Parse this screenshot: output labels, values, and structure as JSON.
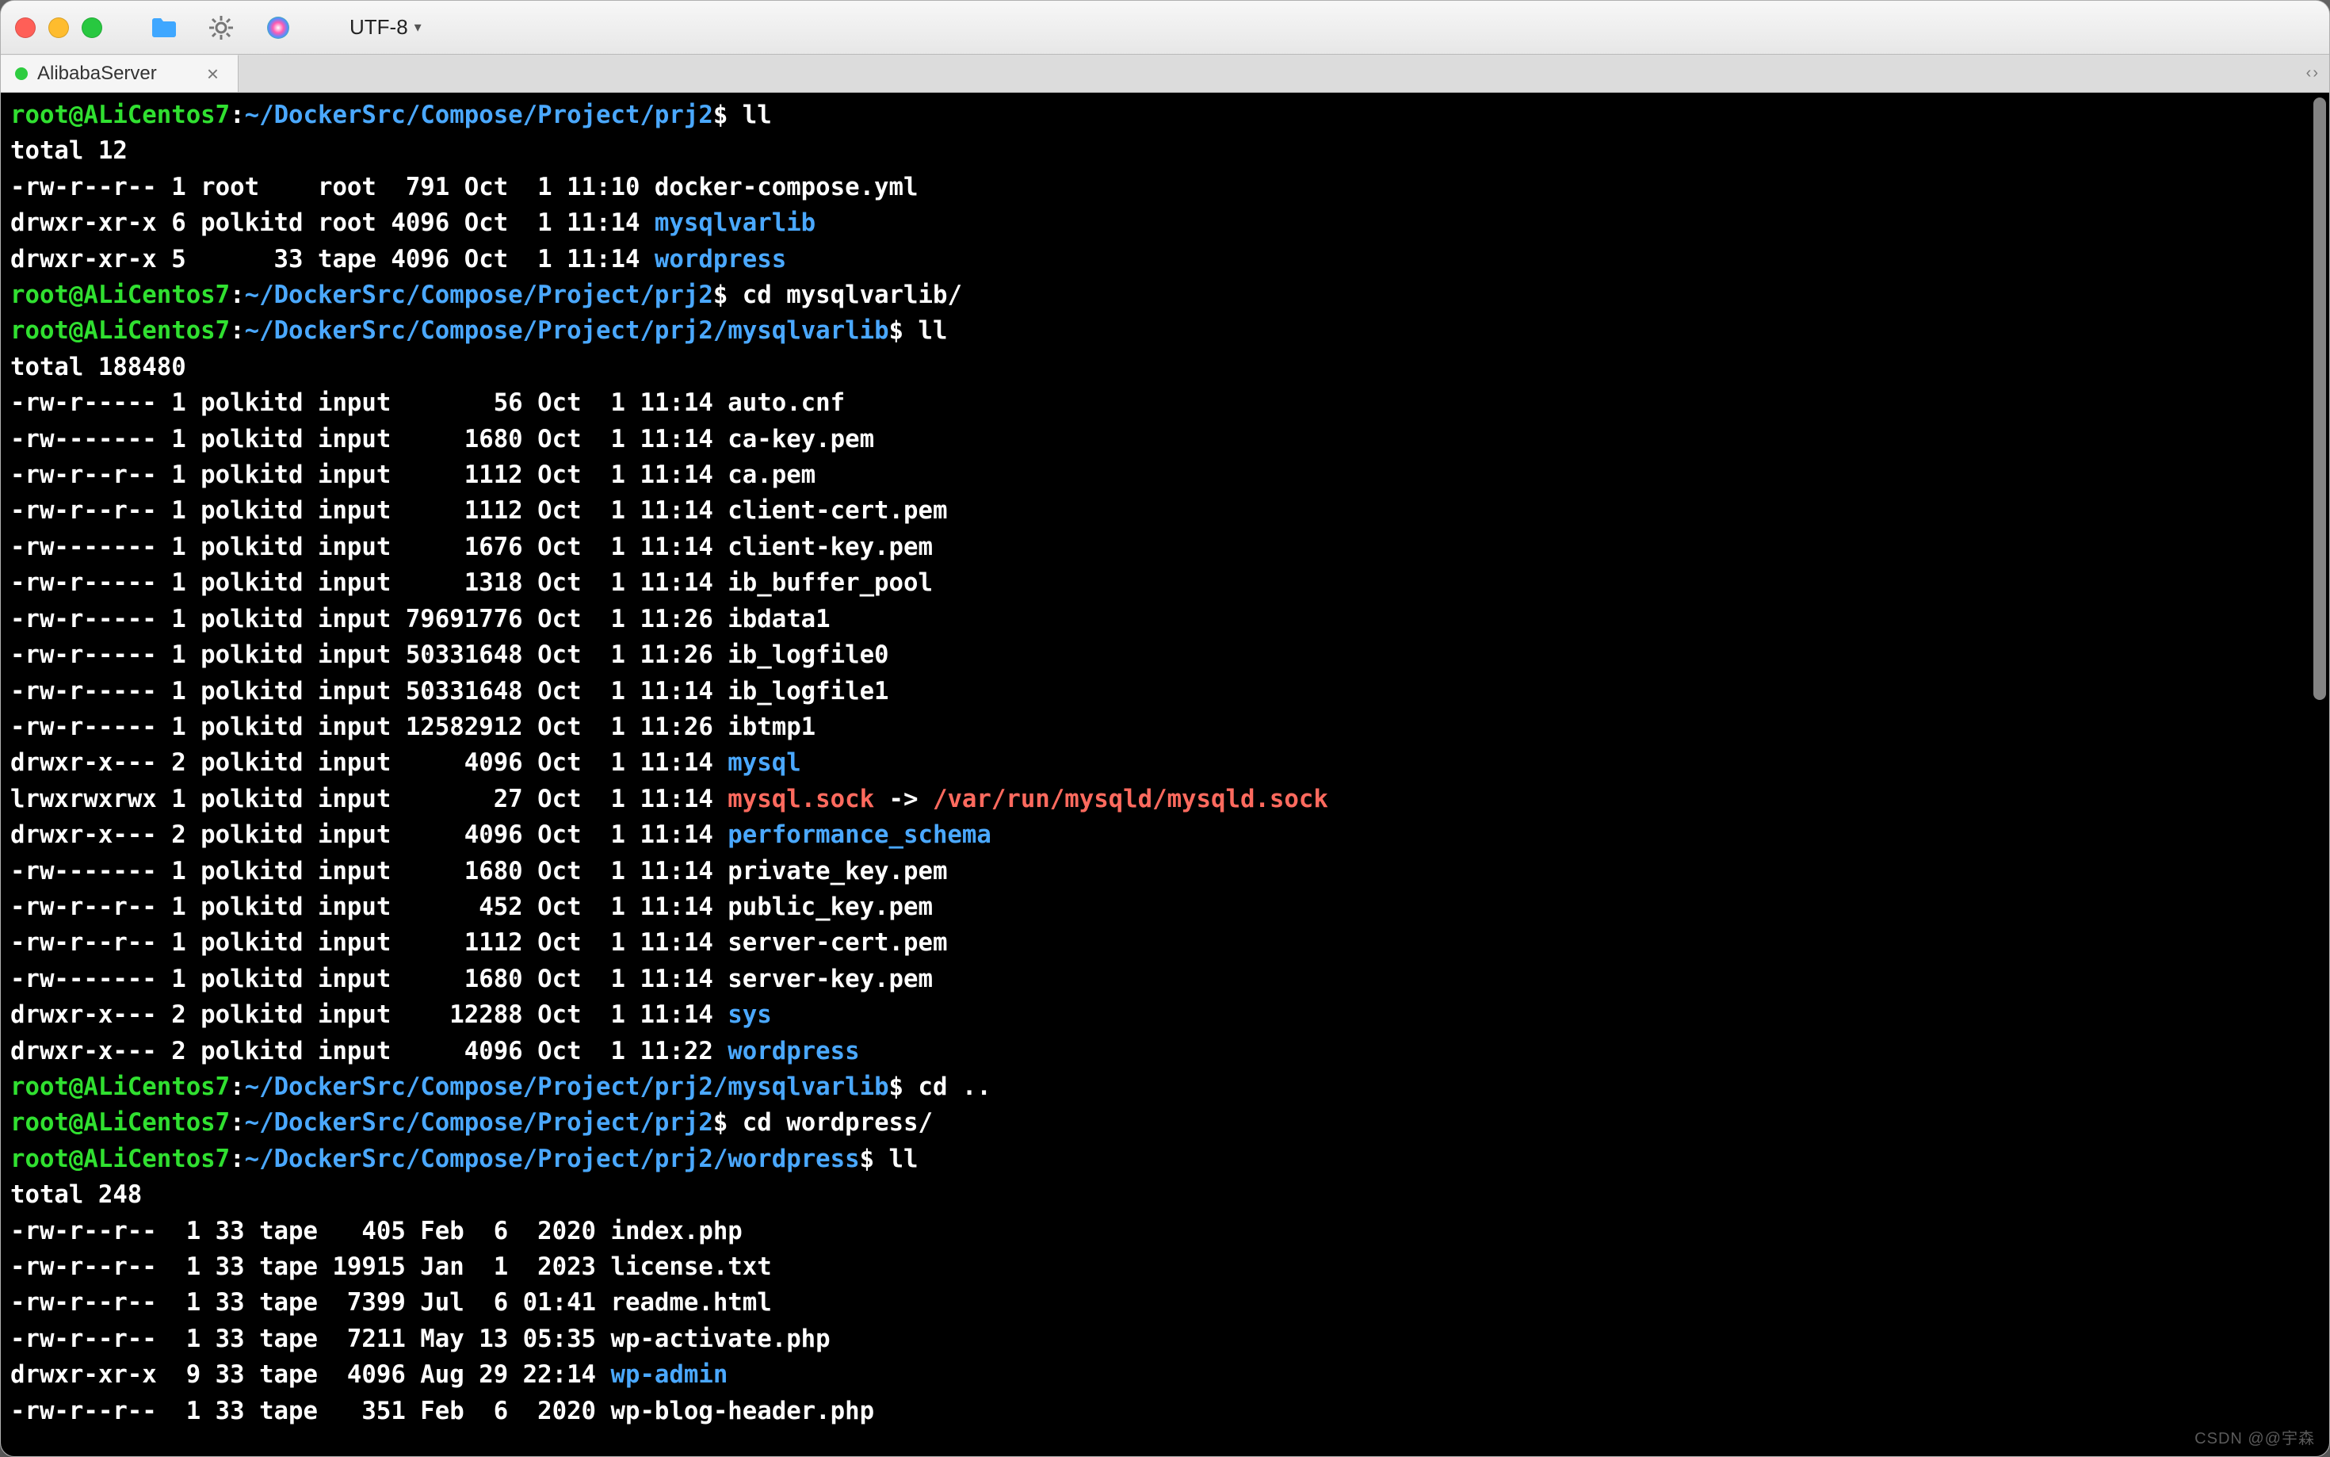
{
  "toolbar": {
    "encoding_label": "UTF-8",
    "folder_icon": "folder-icon",
    "gear_icon": "gear-icon",
    "color_icon": "color-picker-icon"
  },
  "tab": {
    "title": "AlibabaServer",
    "close_glyph": "×",
    "nav_left": "‹",
    "nav_right": "›"
  },
  "term": {
    "prompts": [
      {
        "userhost": "root@ALiCentos7",
        "sep": ":",
        "path": "~/DockerSrc/Compose/Project/prj2",
        "cmd": "ll"
      },
      {
        "userhost": "root@ALiCentos7",
        "sep": ":",
        "path": "~/DockerSrc/Compose/Project/prj2",
        "cmd": "cd mysqlvarlib/"
      },
      {
        "userhost": "root@ALiCentos7",
        "sep": ":",
        "path": "~/DockerSrc/Compose/Project/prj2/mysqlvarlib",
        "cmd": "ll"
      },
      {
        "userhost": "root@ALiCentos7",
        "sep": ":",
        "path": "~/DockerSrc/Compose/Project/prj2/mysqlvarlib",
        "cmd": "cd .."
      },
      {
        "userhost": "root@ALiCentos7",
        "sep": ":",
        "path": "~/DockerSrc/Compose/Project/prj2",
        "cmd": "cd wordpress/"
      },
      {
        "userhost": "root@ALiCentos7",
        "sep": ":",
        "path": "~/DockerSrc/Compose/Project/prj2/wordpress",
        "cmd": "ll"
      }
    ],
    "block1": {
      "total": "total 12",
      "rows": [
        {
          "perm": "-rw-r--r--",
          "n": "1",
          "own": "root   ",
          "grp": "root",
          "size": " 791",
          "date": "Oct  1 11:10",
          "name": "docker-compose.yml",
          "dir": false
        },
        {
          "perm": "drwxr-xr-x",
          "n": "6",
          "own": "polkitd",
          "grp": "root",
          "size": "4096",
          "date": "Oct  1 11:14",
          "name": "mysqlvarlib",
          "dir": true
        },
        {
          "perm": "drwxr-xr-x",
          "n": "5",
          "own": "     33",
          "grp": "tape",
          "size": "4096",
          "date": "Oct  1 11:14",
          "name": "wordpress",
          "dir": true
        }
      ]
    },
    "block2": {
      "total": "total 188480",
      "rows": [
        {
          "perm": "-rw-r-----",
          "n": "1",
          "own": "polkitd",
          "grp": "input",
          "size": "      56",
          "date": "Oct  1 11:14",
          "name": "auto.cnf",
          "dir": false
        },
        {
          "perm": "-rw-------",
          "n": "1",
          "own": "polkitd",
          "grp": "input",
          "size": "    1680",
          "date": "Oct  1 11:14",
          "name": "ca-key.pem",
          "dir": false
        },
        {
          "perm": "-rw-r--r--",
          "n": "1",
          "own": "polkitd",
          "grp": "input",
          "size": "    1112",
          "date": "Oct  1 11:14",
          "name": "ca.pem",
          "dir": false
        },
        {
          "perm": "-rw-r--r--",
          "n": "1",
          "own": "polkitd",
          "grp": "input",
          "size": "    1112",
          "date": "Oct  1 11:14",
          "name": "client-cert.pem",
          "dir": false
        },
        {
          "perm": "-rw-------",
          "n": "1",
          "own": "polkitd",
          "grp": "input",
          "size": "    1676",
          "date": "Oct  1 11:14",
          "name": "client-key.pem",
          "dir": false
        },
        {
          "perm": "-rw-r-----",
          "n": "1",
          "own": "polkitd",
          "grp": "input",
          "size": "    1318",
          "date": "Oct  1 11:14",
          "name": "ib_buffer_pool",
          "dir": false
        },
        {
          "perm": "-rw-r-----",
          "n": "1",
          "own": "polkitd",
          "grp": "input",
          "size": "79691776",
          "date": "Oct  1 11:26",
          "name": "ibdata1",
          "dir": false
        },
        {
          "perm": "-rw-r-----",
          "n": "1",
          "own": "polkitd",
          "grp": "input",
          "size": "50331648",
          "date": "Oct  1 11:26",
          "name": "ib_logfile0",
          "dir": false
        },
        {
          "perm": "-rw-r-----",
          "n": "1",
          "own": "polkitd",
          "grp": "input",
          "size": "50331648",
          "date": "Oct  1 11:14",
          "name": "ib_logfile1",
          "dir": false
        },
        {
          "perm": "-rw-r-----",
          "n": "1",
          "own": "polkitd",
          "grp": "input",
          "size": "12582912",
          "date": "Oct  1 11:26",
          "name": "ibtmp1",
          "dir": false
        },
        {
          "perm": "drwxr-x---",
          "n": "2",
          "own": "polkitd",
          "grp": "input",
          "size": "    4096",
          "date": "Oct  1 11:14",
          "name": "mysql",
          "dir": true
        },
        {
          "perm": "lrwxrwxrwx",
          "n": "1",
          "own": "polkitd",
          "grp": "input",
          "size": "      27",
          "date": "Oct  1 11:14",
          "name": "mysql.sock",
          "link": "/var/run/mysqld/mysqld.sock",
          "dir": false,
          "sym": true
        },
        {
          "perm": "drwxr-x---",
          "n": "2",
          "own": "polkitd",
          "grp": "input",
          "size": "    4096",
          "date": "Oct  1 11:14",
          "name": "performance_schema",
          "dir": true
        },
        {
          "perm": "-rw-------",
          "n": "1",
          "own": "polkitd",
          "grp": "input",
          "size": "    1680",
          "date": "Oct  1 11:14",
          "name": "private_key.pem",
          "dir": false
        },
        {
          "perm": "-rw-r--r--",
          "n": "1",
          "own": "polkitd",
          "grp": "input",
          "size": "     452",
          "date": "Oct  1 11:14",
          "name": "public_key.pem",
          "dir": false
        },
        {
          "perm": "-rw-r--r--",
          "n": "1",
          "own": "polkitd",
          "grp": "input",
          "size": "    1112",
          "date": "Oct  1 11:14",
          "name": "server-cert.pem",
          "dir": false
        },
        {
          "perm": "-rw-------",
          "n": "1",
          "own": "polkitd",
          "grp": "input",
          "size": "    1680",
          "date": "Oct  1 11:14",
          "name": "server-key.pem",
          "dir": false
        },
        {
          "perm": "drwxr-x---",
          "n": "2",
          "own": "polkitd",
          "grp": "input",
          "size": "   12288",
          "date": "Oct  1 11:14",
          "name": "sys",
          "dir": true
        },
        {
          "perm": "drwxr-x---",
          "n": "2",
          "own": "polkitd",
          "grp": "input",
          "size": "    4096",
          "date": "Oct  1 11:22",
          "name": "wordpress",
          "dir": true
        }
      ]
    },
    "block3": {
      "total": "total 248",
      "rows": [
        {
          "perm": "-rw-r--r-- ",
          "n": "1",
          "own": "33",
          "grp": "tape",
          "size": "  405",
          "date": "Feb  6  2020",
          "name": "index.php",
          "dir": false
        },
        {
          "perm": "-rw-r--r-- ",
          "n": "1",
          "own": "33",
          "grp": "tape",
          "size": "19915",
          "date": "Jan  1  2023",
          "name": "license.txt",
          "dir": false
        },
        {
          "perm": "-rw-r--r-- ",
          "n": "1",
          "own": "33",
          "grp": "tape",
          "size": " 7399",
          "date": "Jul  6 01:41",
          "name": "readme.html",
          "dir": false
        },
        {
          "perm": "-rw-r--r-- ",
          "n": "1",
          "own": "33",
          "grp": "tape",
          "size": " 7211",
          "date": "May 13 05:35",
          "name": "wp-activate.php",
          "dir": false
        },
        {
          "perm": "drwxr-xr-x ",
          "n": "9",
          "own": "33",
          "grp": "tape",
          "size": " 4096",
          "date": "Aug 29 22:14",
          "name": "wp-admin",
          "dir": true
        },
        {
          "perm": "-rw-r--r-- ",
          "n": "1",
          "own": "33",
          "grp": "tape",
          "size": "  351",
          "date": "Feb  6  2020",
          "name": "wp-blog-header.php",
          "dir": false
        }
      ]
    },
    "dollar": "$",
    "arrow": " -> "
  },
  "watermark": "CSDN @@宇森"
}
